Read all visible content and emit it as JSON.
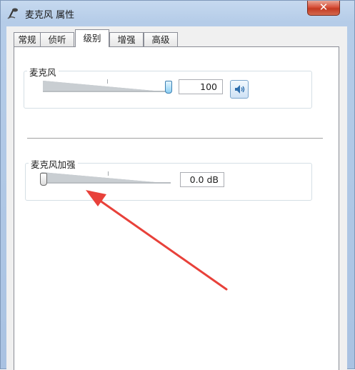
{
  "window": {
    "title": "麦克风 属性",
    "close_label": "✕"
  },
  "tabs": [
    {
      "label": "常规",
      "active": false
    },
    {
      "label": "侦听",
      "active": false
    },
    {
      "label": "级别",
      "active": true
    },
    {
      "label": "增强",
      "active": false
    },
    {
      "label": "高级",
      "active": false
    }
  ],
  "microphone": {
    "label": "麦克风",
    "value": "100",
    "level": 100
  },
  "boost": {
    "label": "麦克风加强",
    "value": "0.0 dB",
    "level": 0
  },
  "icons": {
    "window_icon": "microphone-icon",
    "speaker": "speaker-icon"
  },
  "colors": {
    "annotation_arrow": "#e8413a",
    "close_button": "#c8452c"
  }
}
